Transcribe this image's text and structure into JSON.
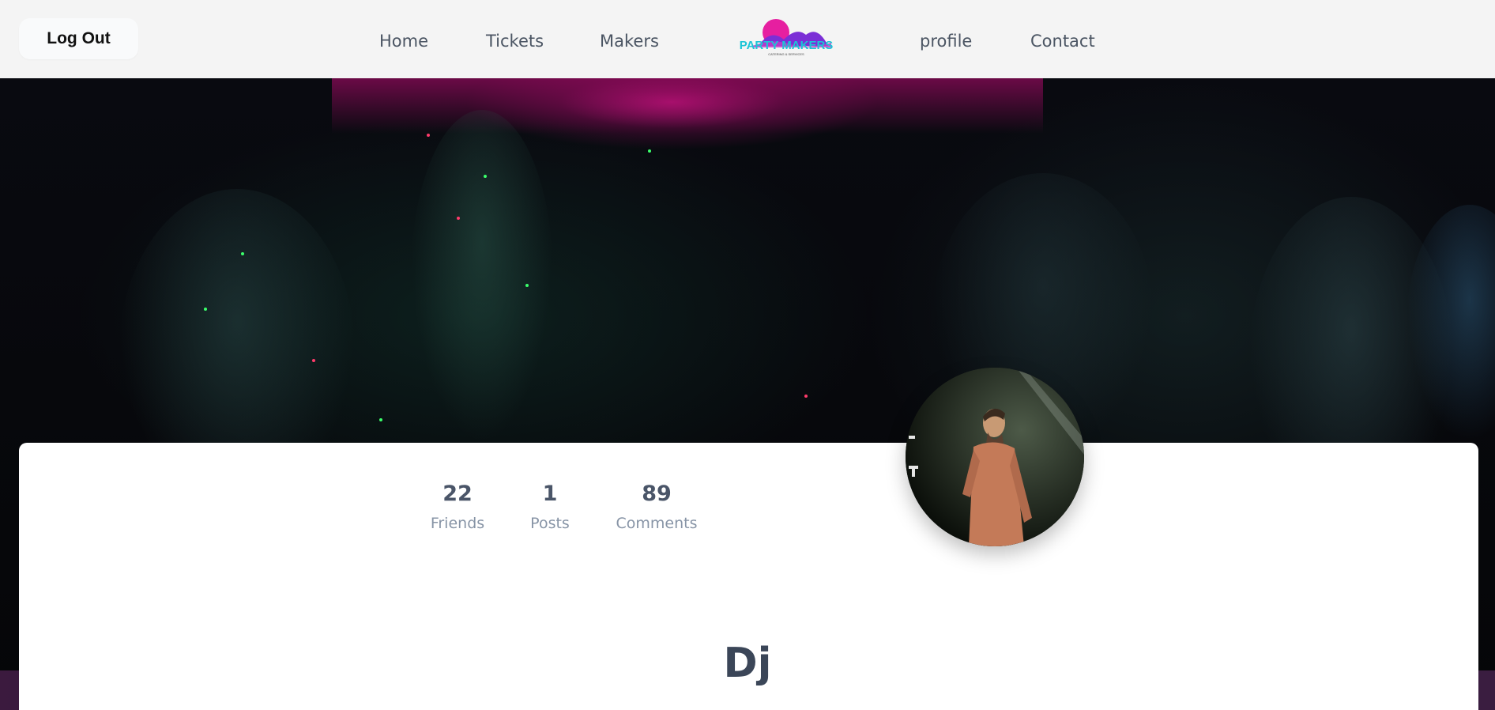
{
  "header": {
    "logout_label": "Log Out",
    "nav": {
      "home": "Home",
      "tickets": "Tickets",
      "makers": "Makers",
      "profile": "profile",
      "contact": "Contact"
    },
    "logo": {
      "text": "PARTY MAKERS",
      "tagline": "CATERING & SERVICES",
      "colors": {
        "wave_pink": "#e61fa0",
        "wave_purple": "#7b2fd6",
        "text_cyan": "#1cc4d6"
      }
    }
  },
  "profile": {
    "stats": [
      {
        "value": "22",
        "label": "Friends"
      },
      {
        "value": "1",
        "label": "Posts"
      },
      {
        "value": "89",
        "label": "Comments"
      }
    ],
    "name": "Dj"
  },
  "colors": {
    "header_bg": "#f4f4f4",
    "nav_text": "#4b5563",
    "stat_value": "#4a5568",
    "stat_label": "#8794a6",
    "name_text": "#3b4658",
    "hero_accent": "#c8148a"
  }
}
